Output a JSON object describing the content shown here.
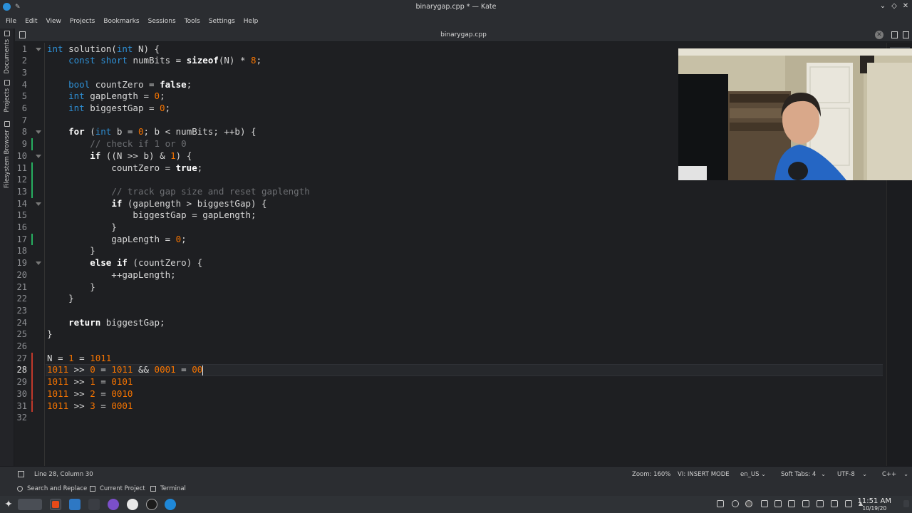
{
  "window": {
    "title": "binarygap.cpp * — Kate"
  },
  "menu": [
    "File",
    "Edit",
    "View",
    "Projects",
    "Bookmarks",
    "Sessions",
    "Tools",
    "Settings",
    "Help"
  ],
  "sidebar": {
    "tabs": [
      "Documents",
      "Projects",
      "Filesystem Browser"
    ]
  },
  "tab": {
    "name": "binarygap.cpp"
  },
  "editor": {
    "current_line": 28,
    "lines": [
      [
        [
          "kw",
          "int"
        ],
        [
          "plain",
          " solution("
        ],
        [
          "kw",
          "int"
        ],
        [
          "plain",
          " N) {"
        ]
      ],
      [
        [
          "plain",
          "    "
        ],
        [
          "kw",
          "const"
        ],
        [
          "plain",
          " "
        ],
        [
          "kw",
          "short"
        ],
        [
          "plain",
          " numBits = "
        ],
        [
          "kwb",
          "sizeof"
        ],
        [
          "plain",
          "(N) * "
        ],
        [
          "num",
          "8"
        ],
        [
          "plain",
          ";"
        ]
      ],
      [],
      [
        [
          "plain",
          "    "
        ],
        [
          "kw",
          "bool"
        ],
        [
          "plain",
          " countZero = "
        ],
        [
          "kwb",
          "false"
        ],
        [
          "plain",
          ";"
        ]
      ],
      [
        [
          "plain",
          "    "
        ],
        [
          "kw",
          "int"
        ],
        [
          "plain",
          " gapLength = "
        ],
        [
          "num",
          "0"
        ],
        [
          "plain",
          ";"
        ]
      ],
      [
        [
          "plain",
          "    "
        ],
        [
          "kw",
          "int"
        ],
        [
          "plain",
          " biggestGap = "
        ],
        [
          "num",
          "0"
        ],
        [
          "plain",
          ";"
        ]
      ],
      [],
      [
        [
          "plain",
          "    "
        ],
        [
          "kwb",
          "for"
        ],
        [
          "plain",
          " ("
        ],
        [
          "kw",
          "int"
        ],
        [
          "plain",
          " b = "
        ],
        [
          "num",
          "0"
        ],
        [
          "plain",
          "; b < numBits; ++b) {"
        ]
      ],
      [
        [
          "plain",
          "        "
        ],
        [
          "cm",
          "// check if 1 or 0"
        ]
      ],
      [
        [
          "plain",
          "        "
        ],
        [
          "kwb",
          "if"
        ],
        [
          "plain",
          " ((N >> b) & "
        ],
        [
          "num",
          "1"
        ],
        [
          "plain",
          ") {"
        ]
      ],
      [
        [
          "plain",
          "            countZero = "
        ],
        [
          "kwb",
          "true"
        ],
        [
          "plain",
          ";"
        ]
      ],
      [],
      [
        [
          "plain",
          "            "
        ],
        [
          "cm",
          "// track gap size and reset gaplength"
        ]
      ],
      [
        [
          "plain",
          "            "
        ],
        [
          "kwb",
          "if"
        ],
        [
          "plain",
          " (gapLength > biggestGap) {"
        ]
      ],
      [
        [
          "plain",
          "                biggestGap = gapLength;"
        ]
      ],
      [
        [
          "plain",
          "            }"
        ]
      ],
      [
        [
          "plain",
          "            gapLength = "
        ],
        [
          "num",
          "0"
        ],
        [
          "plain",
          ";"
        ]
      ],
      [
        [
          "plain",
          "        }"
        ]
      ],
      [
        [
          "plain",
          "        "
        ],
        [
          "kwb",
          "else if"
        ],
        [
          "plain",
          " (countZero) {"
        ]
      ],
      [
        [
          "plain",
          "            ++gapLength;"
        ]
      ],
      [
        [
          "plain",
          "        }"
        ]
      ],
      [
        [
          "plain",
          "    }"
        ]
      ],
      [],
      [
        [
          "plain",
          "    "
        ],
        [
          "kwb",
          "return"
        ],
        [
          "plain",
          " biggestGap;"
        ]
      ],
      [
        [
          "plain",
          "}"
        ]
      ],
      [],
      [
        [
          "plain",
          "N = "
        ],
        [
          "num",
          "1"
        ],
        [
          "plain",
          " = "
        ],
        [
          "num",
          "1011"
        ]
      ],
      [
        [
          "num",
          "1011"
        ],
        [
          "plain",
          " >> "
        ],
        [
          "num",
          "0"
        ],
        [
          "plain",
          " = "
        ],
        [
          "num",
          "1011"
        ],
        [
          "plain",
          " && "
        ],
        [
          "num",
          "0001"
        ],
        [
          "plain",
          " = "
        ],
        [
          "num",
          "00"
        ]
      ],
      [
        [
          "num",
          "1011"
        ],
        [
          "plain",
          " >> "
        ],
        [
          "num",
          "1"
        ],
        [
          "plain",
          " = "
        ],
        [
          "num",
          "0101"
        ]
      ],
      [
        [
          "num",
          "1011"
        ],
        [
          "plain",
          " >> "
        ],
        [
          "num",
          "2"
        ],
        [
          "plain",
          " = "
        ],
        [
          "num",
          "0010"
        ]
      ],
      [
        [
          "num",
          "1011"
        ],
        [
          "plain",
          " >> "
        ],
        [
          "num",
          "3"
        ],
        [
          "plain",
          " = "
        ],
        [
          "num",
          "0001"
        ]
      ],
      []
    ],
    "line_numbers": [
      "1",
      "2",
      "3",
      "4",
      "5",
      "6",
      "7",
      "8",
      "9",
      "10",
      "11",
      "12",
      "13",
      "14",
      "15",
      "16",
      "17",
      "18",
      "19",
      "20",
      "21",
      "22",
      "23",
      "24",
      "25",
      "26",
      "27",
      "28",
      "29",
      "30",
      "31",
      "32"
    ]
  },
  "status": {
    "position": "Line 28, Column 30",
    "zoom": "Zoom: 160%",
    "mode": "VI: INSERT MODE",
    "language": "en_US",
    "tabs": "Soft Tabs: 4",
    "encoding": "UTF-8",
    "syntax": "C++"
  },
  "tools": {
    "search": "Search and Replace",
    "project": "Current Project",
    "terminal": "Terminal"
  },
  "clock": {
    "time": "11:51 AM",
    "date": "10/19/20"
  },
  "colors": {
    "keyword": "#2e8fd4",
    "number": "#f67400",
    "comment": "#6d6f73",
    "background": "#1e1f22"
  }
}
